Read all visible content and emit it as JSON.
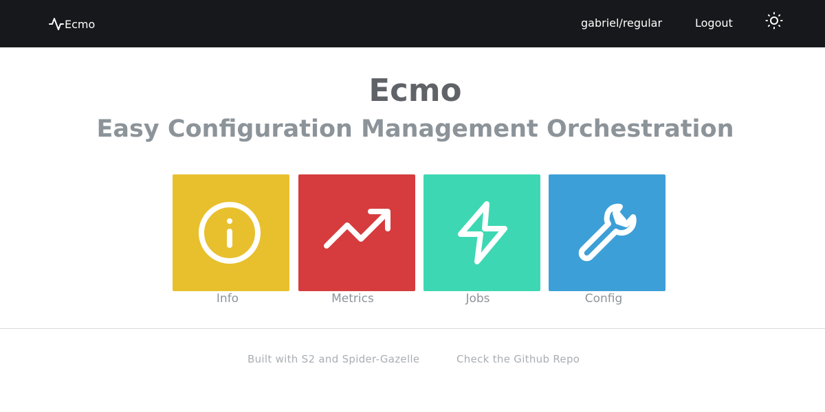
{
  "nav": {
    "brand": "Ecmo",
    "user": "gabriel/regular",
    "logout": "Logout",
    "theme_icon": "sun-icon"
  },
  "hero": {
    "title": "Ecmo",
    "subtitle": "Easy Configuration Management Orchestration"
  },
  "tiles": [
    {
      "label": "Info",
      "icon": "info-icon",
      "color": "#e8c02d"
    },
    {
      "label": "Metrics",
      "icon": "trending-up-icon",
      "color": "#d63c3d"
    },
    {
      "label": "Jobs",
      "icon": "lightning-bolt-icon",
      "color": "#3dd8b3"
    },
    {
      "label": "Config",
      "icon": "wrench-icon",
      "color": "#3d9fd7"
    }
  ],
  "footer": {
    "built_with": "Built with S2 and Spider-Gazelle",
    "repo": "Check the Github Repo"
  },
  "colors": {
    "navbar_bg": "#17181b",
    "title": "#5f6368",
    "subtitle": "#8c949a",
    "footer_text": "#a9aeb2"
  }
}
